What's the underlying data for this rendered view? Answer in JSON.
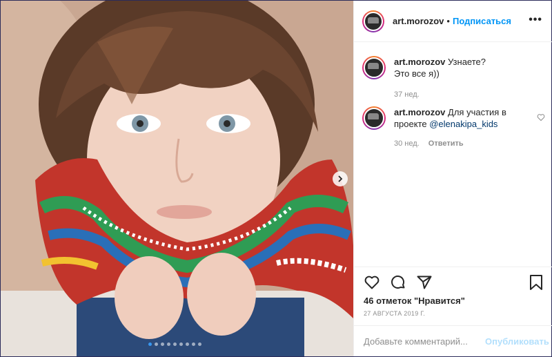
{
  "post": {
    "username": "art.morozov",
    "separator": "•",
    "follow_label": "Подписаться",
    "more_label": "•••"
  },
  "comments": [
    {
      "username": "art.morozov",
      "text_line1": "Узнаете?",
      "text_line2": "Это все я))",
      "time": "37 нед."
    },
    {
      "username": "art.morozov",
      "text": "Для участия в проекте",
      "mention": "@elenakipa_kids",
      "time": "30 нед.",
      "reply_label": "Ответить"
    }
  ],
  "actions": {
    "likes": "46 отметок \"Нравится\"",
    "date": "27 АВГУСТА 2019 Г."
  },
  "comment_box": {
    "placeholder": "Добавьте комментарий...",
    "post_label": "Опубликовать"
  },
  "carousel": {
    "total": 9,
    "active": 1
  },
  "colors": {
    "accent": "#0095f6",
    "muted": "#8e8e8e",
    "post_disabled": "#b2dffc",
    "active_dot": "#3897f0"
  }
}
